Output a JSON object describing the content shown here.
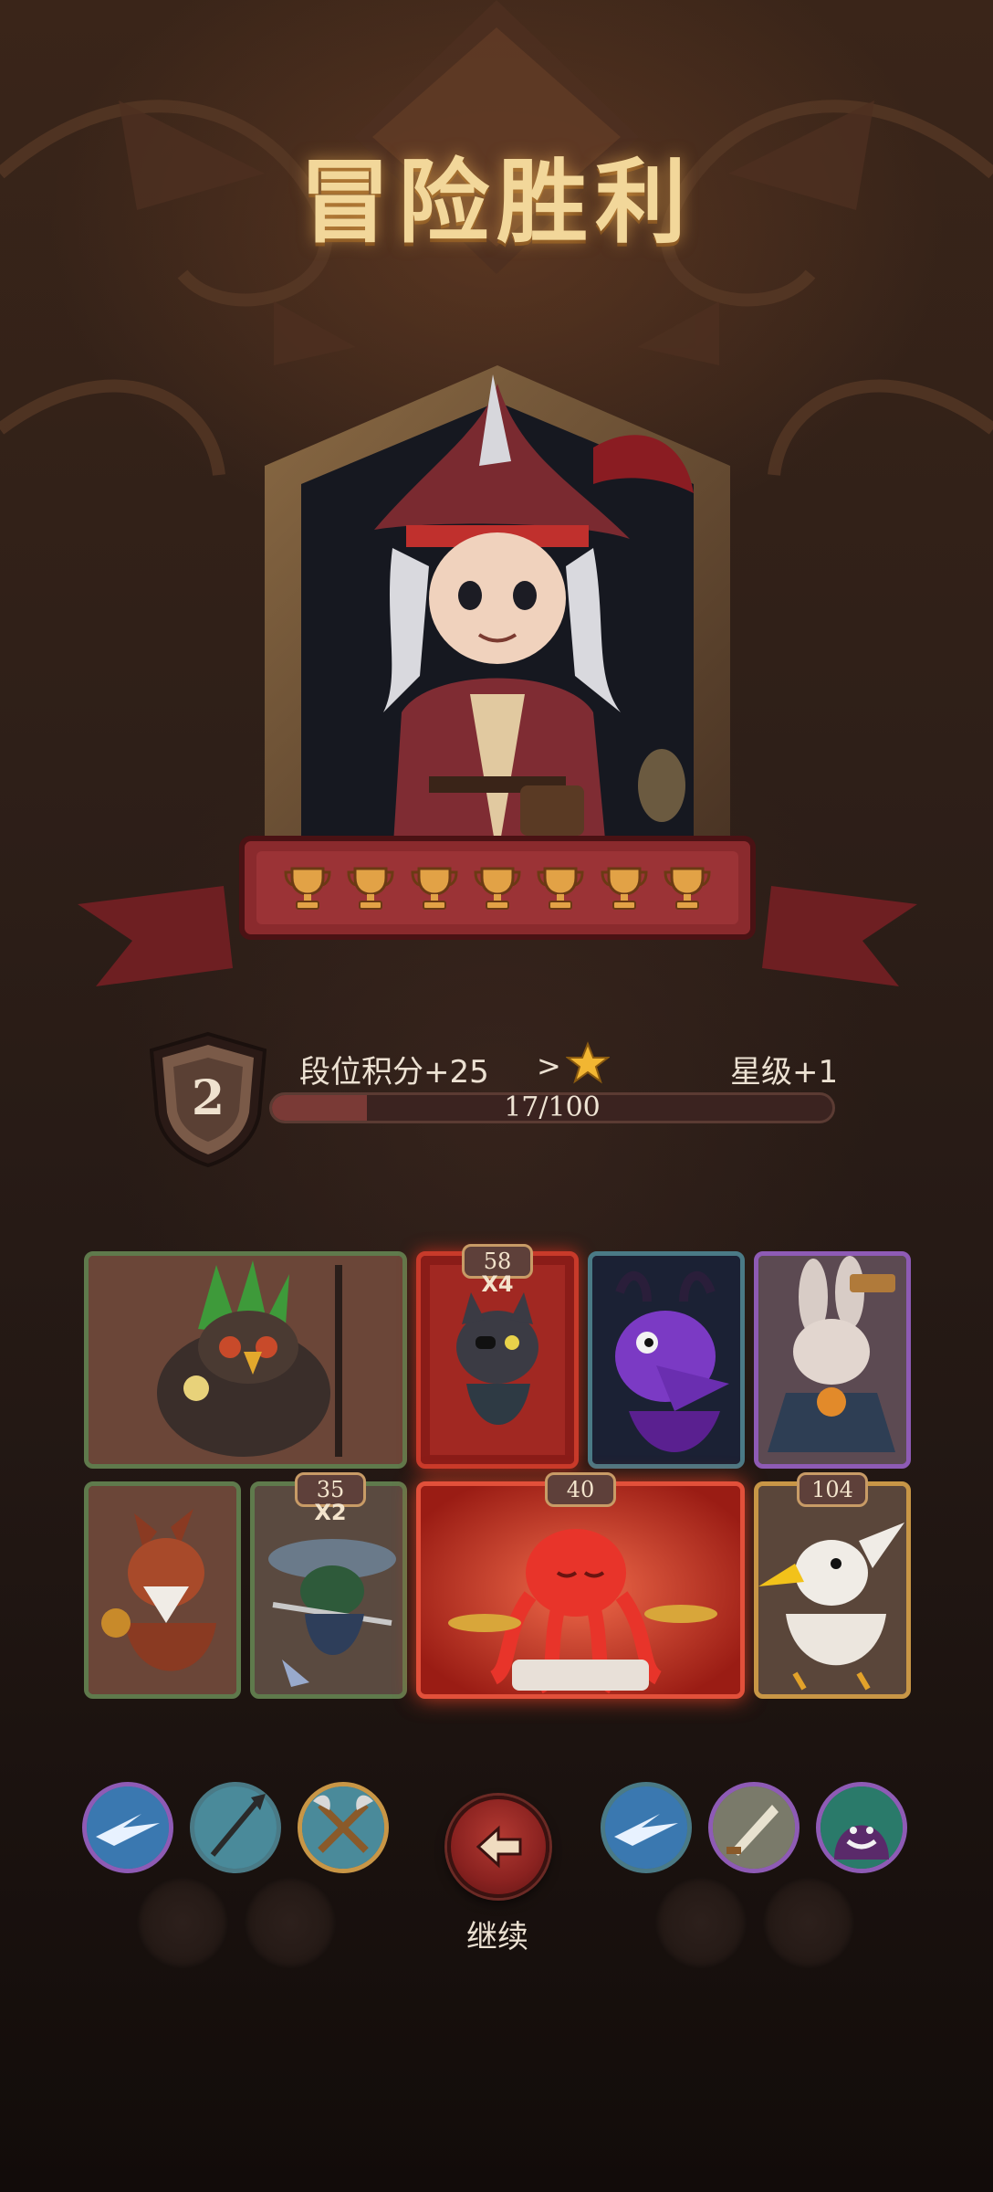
{
  "header": {
    "title": "冒险胜利"
  },
  "hero": {
    "name": "pirate-captain",
    "trophy_count": 7
  },
  "rank": {
    "level": "2",
    "points_label": "段位积分+25",
    "arrow": ">",
    "star_label": "星级+1",
    "progress_text": "17/100",
    "progress_fraction": 0.17
  },
  "cards": {
    "owl_shaman": {
      "name": "owl-shaman"
    },
    "pirate_cat": {
      "name": "pirate-cat",
      "badge": "58",
      "multiplier": "X4"
    },
    "purple_dragon": {
      "name": "purple-dragon"
    },
    "rabbit_scarecrow": {
      "name": "rabbit-scarecrow"
    },
    "squirrel_monk": {
      "name": "squirrel-monk"
    },
    "frog_swordsman": {
      "name": "frog-swordsman",
      "badge": "35",
      "multiplier": "X2"
    },
    "octopus_drummer": {
      "name": "octopus-drummer",
      "badge": "40"
    },
    "eagle_brawler": {
      "name": "eagle-brawler",
      "badge": "104"
    }
  },
  "skills_left": [
    "slash-skill-icon",
    "spear-skill-icon",
    "crossed-axes-skill-icon"
  ],
  "skills_right": [
    "slash-skill-icon",
    "blade-skill-icon",
    "shadow-laugh-skill-icon"
  ],
  "actions": {
    "continue_label": "继续"
  },
  "colors": {
    "frame_green": "#5f7a4c",
    "frame_red": "#c83a2a",
    "frame_blue": "#4a7a86",
    "frame_purple": "#8e5bb5",
    "frame_gold": "#c89646",
    "star": "#f2b632",
    "trophy": "#e2a246"
  }
}
